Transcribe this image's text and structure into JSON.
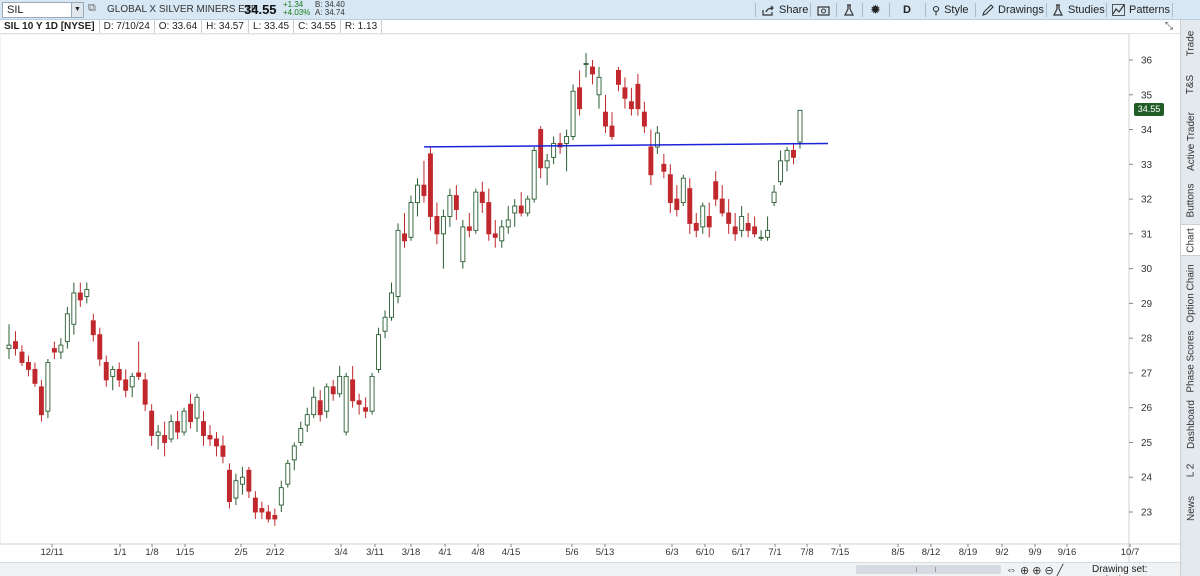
{
  "toolbar": {
    "symbol_value": "SIL",
    "description": "GLOBAL X SILVER MINERS ETF",
    "last_price": "34.55",
    "net_change": "+1.34",
    "pct_change": "+4.03%",
    "bid": "B: 34.40",
    "ask": "A: 34.74",
    "share_label": "Share",
    "aggregation_label": "D",
    "style_label": "Style",
    "drawings_label": "Drawings",
    "studies_label": "Studies",
    "patterns_label": "Patterns",
    "accent_color": "#d7e8f4"
  },
  "header": {
    "symbol": "SIL 10 Y 1D [NYSE]",
    "date": "D: 7/10/24",
    "open": "O: 33.64",
    "high": "H: 34.57",
    "low": "L: 33.45",
    "close": "C: 34.55",
    "range": "R: 1.13"
  },
  "side_tabs": [
    "Trade",
    "T&S",
    "Active Trader",
    "Buttons",
    "Chart",
    "Option Chain",
    "Phase Scores",
    "Dashboard",
    "L 2",
    "News"
  ],
  "active_side_tab": "Chart",
  "price_badge": "34.55",
  "bottom": {
    "drawing_set": "Drawing set: Default"
  },
  "chart_data": {
    "type": "candlestick",
    "y_ticks": [
      23,
      24,
      25,
      26,
      27,
      28,
      29,
      30,
      31,
      32,
      33,
      34,
      35,
      36
    ],
    "ylim": [
      22.4,
      36.9
    ],
    "x_tick_labels": [
      "12/11",
      "1/1",
      "1/8",
      "1/15",
      "2/5",
      "2/12",
      "3/4",
      "3/11",
      "3/18",
      "4/1",
      "4/8",
      "4/15",
      "5/6",
      "5/13",
      "6/3",
      "6/10",
      "6/17",
      "7/1",
      "7/8",
      "7/15",
      "8/5",
      "8/12",
      "8/19",
      "9/2",
      "9/9",
      "9/16",
      "10/7"
    ],
    "up_color": "#1e6b2a",
    "down_color": "#c0282d",
    "line_color": "#1b23d6",
    "trend_line": {
      "start": [
        33.5
      ],
      "end": [
        33.6
      ]
    },
    "candles": [
      [
        27.7,
        28.4,
        27.4,
        27.8
      ],
      [
        27.9,
        28.2,
        27.5,
        27.7
      ],
      [
        27.6,
        27.8,
        27.2,
        27.3
      ],
      [
        27.3,
        27.5,
        26.9,
        27.1
      ],
      [
        27.1,
        27.3,
        26.6,
        26.7
      ],
      [
        26.6,
        26.8,
        25.6,
        25.8
      ],
      [
        25.9,
        27.4,
        25.7,
        27.3
      ],
      [
        27.7,
        27.9,
        27.4,
        27.6
      ],
      [
        27.6,
        28.0,
        27.4,
        27.8
      ],
      [
        27.9,
        28.9,
        27.7,
        28.7
      ],
      [
        28.4,
        29.6,
        28.1,
        29.3
      ],
      [
        29.3,
        29.6,
        28.9,
        29.1
      ],
      [
        29.2,
        29.6,
        29.0,
        29.4
      ],
      [
        28.5,
        28.7,
        27.9,
        28.1
      ],
      [
        28.1,
        28.3,
        27.2,
        27.4
      ],
      [
        27.3,
        27.5,
        26.6,
        26.8
      ],
      [
        26.9,
        27.2,
        26.5,
        27.1
      ],
      [
        27.1,
        27.3,
        26.6,
        26.8
      ],
      [
        26.8,
        27.1,
        26.3,
        26.5
      ],
      [
        26.6,
        27.0,
        26.3,
        26.9
      ],
      [
        27.0,
        27.9,
        26.8,
        26.9
      ],
      [
        26.8,
        27.0,
        25.9,
        26.1
      ],
      [
        25.9,
        26.1,
        24.9,
        25.2
      ],
      [
        25.2,
        25.5,
        24.8,
        25.3
      ],
      [
        25.2,
        25.6,
        24.6,
        25.0
      ],
      [
        25.1,
        25.8,
        25.0,
        25.6
      ],
      [
        25.6,
        25.9,
        25.1,
        25.3
      ],
      [
        25.3,
        26.0,
        25.2,
        25.9
      ],
      [
        26.1,
        26.4,
        25.4,
        25.6
      ],
      [
        25.7,
        26.4,
        25.3,
        26.3
      ],
      [
        25.6,
        25.9,
        24.9,
        25.2
      ],
      [
        25.2,
        25.5,
        24.9,
        25.1
      ],
      [
        25.1,
        25.3,
        24.6,
        24.9
      ],
      [
        24.9,
        25.2,
        24.4,
        24.6
      ],
      [
        24.2,
        24.4,
        23.1,
        23.3
      ],
      [
        23.4,
        24.1,
        23.2,
        23.9
      ],
      [
        23.8,
        24.3,
        23.5,
        24.0
      ],
      [
        24.2,
        24.3,
        23.4,
        23.6
      ],
      [
        23.4,
        23.6,
        22.8,
        23.0
      ],
      [
        23.1,
        23.3,
        22.8,
        23.0
      ],
      [
        23.0,
        23.2,
        22.7,
        22.8
      ],
      [
        22.9,
        23.1,
        22.6,
        22.8
      ],
      [
        23.2,
        23.9,
        23.0,
        23.7
      ],
      [
        23.8,
        24.5,
        23.7,
        24.4
      ],
      [
        24.5,
        25.0,
        24.2,
        24.9
      ],
      [
        25.0,
        25.6,
        24.9,
        25.4
      ],
      [
        25.5,
        26.0,
        25.3,
        25.8
      ],
      [
        25.8,
        26.6,
        25.7,
        26.3
      ],
      [
        26.2,
        26.5,
        25.6,
        25.8
      ],
      [
        25.9,
        26.7,
        25.7,
        26.6
      ],
      [
        26.6,
        26.8,
        26.2,
        26.4
      ],
      [
        26.4,
        27.2,
        26.3,
        26.9
      ],
      [
        25.3,
        27.0,
        25.2,
        26.9
      ],
      [
        26.8,
        27.2,
        26.0,
        26.2
      ],
      [
        26.2,
        26.4,
        25.8,
        26.1
      ],
      [
        26.0,
        26.3,
        25.7,
        25.9
      ],
      [
        25.9,
        27.0,
        25.8,
        26.9
      ],
      [
        27.1,
        28.3,
        27.0,
        28.1
      ],
      [
        28.2,
        28.8,
        28.0,
        28.6
      ],
      [
        28.6,
        29.6,
        28.5,
        29.3
      ],
      [
        29.2,
        31.3,
        29.0,
        31.1
      ],
      [
        31.0,
        31.6,
        30.6,
        30.8
      ],
      [
        30.9,
        32.1,
        30.8,
        31.9
      ],
      [
        31.9,
        32.6,
        31.5,
        32.4
      ],
      [
        32.4,
        33.1,
        31.9,
        32.1
      ],
      [
        33.3,
        33.5,
        31.1,
        31.5
      ],
      [
        31.5,
        31.9,
        30.7,
        31.0
      ],
      [
        31.0,
        31.7,
        30.0,
        31.5
      ],
      [
        31.5,
        32.3,
        31.2,
        32.1
      ],
      [
        32.1,
        32.4,
        31.4,
        31.7
      ],
      [
        30.2,
        31.4,
        30.0,
        31.2
      ],
      [
        31.2,
        31.6,
        30.9,
        31.1
      ],
      [
        31.1,
        32.3,
        31.0,
        32.2
      ],
      [
        32.2,
        32.5,
        31.6,
        31.9
      ],
      [
        31.9,
        32.3,
        30.8,
        31.0
      ],
      [
        31.0,
        31.4,
        30.6,
        30.9
      ],
      [
        30.8,
        31.4,
        30.6,
        31.2
      ],
      [
        31.2,
        31.8,
        31.0,
        31.4
      ],
      [
        31.6,
        32.0,
        31.2,
        31.8
      ],
      [
        31.8,
        32.2,
        31.5,
        31.6
      ],
      [
        31.6,
        32.1,
        31.5,
        32.0
      ],
      [
        32.0,
        33.5,
        31.9,
        33.4
      ],
      [
        34.0,
        34.1,
        32.6,
        32.9
      ],
      [
        32.9,
        33.3,
        32.4,
        33.1
      ],
      [
        33.2,
        33.8,
        33.0,
        33.6
      ],
      [
        33.6,
        33.9,
        33.3,
        33.5
      ],
      [
        33.6,
        34.0,
        32.8,
        33.8
      ],
      [
        33.8,
        35.3,
        33.7,
        35.1
      ],
      [
        35.2,
        35.7,
        34.4,
        34.6
      ],
      [
        35.9,
        36.2,
        35.5,
        35.9
      ],
      [
        35.8,
        36.0,
        35.3,
        35.6
      ],
      [
        35.0,
        35.8,
        34.6,
        35.5
      ],
      [
        34.5,
        35.0,
        33.9,
        34.1
      ],
      [
        34.1,
        34.5,
        33.7,
        33.8
      ],
      [
        35.7,
        35.8,
        35.1,
        35.3
      ],
      [
        35.2,
        35.5,
        34.6,
        34.9
      ],
      [
        34.8,
        35.2,
        34.4,
        34.6
      ],
      [
        35.3,
        35.6,
        34.4,
        34.6
      ],
      [
        34.5,
        34.8,
        33.9,
        34.1
      ],
      [
        33.5,
        34.0,
        32.4,
        32.7
      ],
      [
        33.5,
        34.1,
        33.3,
        33.9
      ],
      [
        33.0,
        33.3,
        32.6,
        32.8
      ],
      [
        32.7,
        33.0,
        31.6,
        31.9
      ],
      [
        32.0,
        32.4,
        31.5,
        31.7
      ],
      [
        31.9,
        32.7,
        31.8,
        32.6
      ],
      [
        32.3,
        32.6,
        31.0,
        31.3
      ],
      [
        31.3,
        31.6,
        30.9,
        31.1
      ],
      [
        31.2,
        31.9,
        31.0,
        31.8
      ],
      [
        31.5,
        31.9,
        30.9,
        31.2
      ],
      [
        32.5,
        32.8,
        31.8,
        32.0
      ],
      [
        32.0,
        32.4,
        31.5,
        31.6
      ],
      [
        31.6,
        32.0,
        31.0,
        31.3
      ],
      [
        31.2,
        31.6,
        30.8,
        31.0
      ],
      [
        31.1,
        31.8,
        30.9,
        31.5
      ],
      [
        31.3,
        31.6,
        30.9,
        31.1
      ],
      [
        31.2,
        31.5,
        30.9,
        31.0
      ],
      [
        30.9,
        31.1,
        30.8,
        30.9
      ],
      [
        30.9,
        31.5,
        30.8,
        31.1
      ],
      [
        31.9,
        32.4,
        31.8,
        32.2
      ],
      [
        32.5,
        33.4,
        32.4,
        33.1
      ],
      [
        33.1,
        33.5,
        32.8,
        33.4
      ],
      [
        33.4,
        33.6,
        33.0,
        33.2
      ],
      [
        33.64,
        34.57,
        33.45,
        34.55
      ]
    ]
  }
}
